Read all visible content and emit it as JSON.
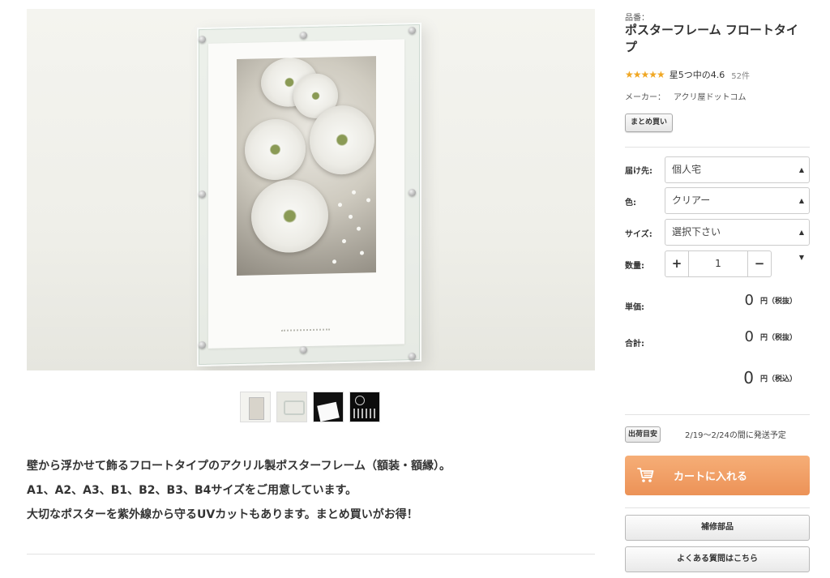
{
  "product": {
    "sku_label": "品番：",
    "title": "ポスターフレーム フロートタイプ",
    "stars": "★★★★★",
    "rating_text": "星5つ中の4.6",
    "review_count": "52件",
    "maker_label": "メーカー：",
    "maker_name": "アクリ屋ドットコム",
    "bulk_badge": "まとめ買い"
  },
  "options": {
    "destination_label": "届け先:",
    "destination_value": "個人宅",
    "color_label": "色:",
    "color_value": "クリアー",
    "size_label": "サイズ:",
    "size_value": "選択下さい",
    "quantity_label": "数量:",
    "quantity_value": "1",
    "plus_symbol": "+",
    "minus_symbol": "−"
  },
  "pricing": {
    "unit_price_label": "単価:",
    "unit_price_value": "0",
    "unit_price_suffix": "円（税抜）",
    "total_label": "合計:",
    "total_value": "0",
    "total_suffix": "円（税抜）",
    "total_incl_value": "0",
    "total_incl_suffix": "円（税込）"
  },
  "shipping": {
    "badge": "出荷目安",
    "text": "2/19〜2/24の間に発送予定"
  },
  "actions": {
    "cart_label": "カートに入れる",
    "parts_label": "補修部品",
    "faq_label": "よくある質問はこちら"
  },
  "gallery": {
    "thumbnails": [
      "thumbnail-front",
      "thumbnail-standoff",
      "thumbnail-black",
      "thumbnail-parts"
    ]
  },
  "description": {
    "line1": "壁から浮かせて飾るフロートタイプのアクリル製ポスターフレーム（額装・額縁）。",
    "line2": "A1、A2、A3、B1、B2、B3、B4サイズをご用意しています。",
    "line3": "大切なポスターを紫外線から守るUVカットもあります。まとめ買いがお得！"
  },
  "colors": {
    "accent_orange": "#ef9a5f",
    "star_color": "#f0a723",
    "text": "#333333"
  }
}
